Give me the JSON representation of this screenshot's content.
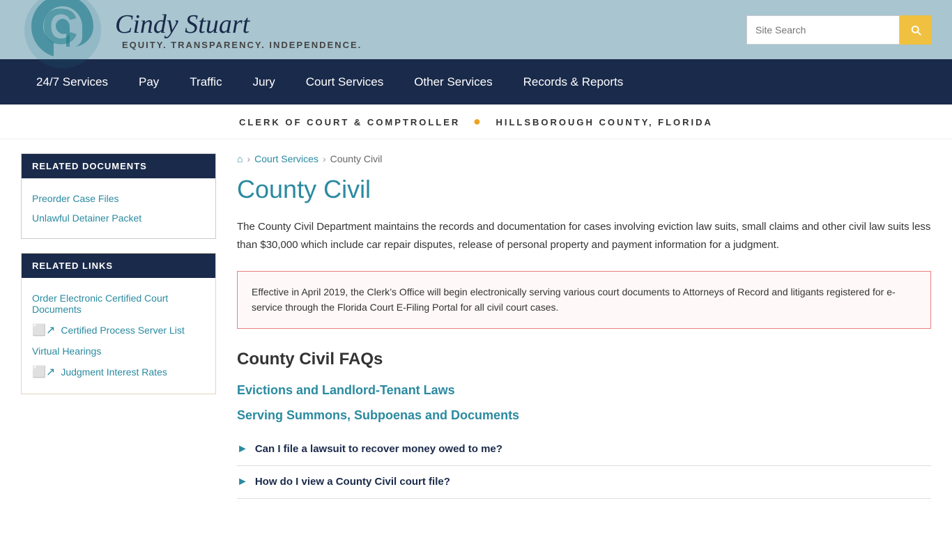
{
  "header": {
    "logo_name": "Cindy Stuart",
    "tagline": "EQUITY. TRANSPARENCY. INDEPENDENCE.",
    "search_placeholder": "Site Search"
  },
  "nav": {
    "items": [
      {
        "label": "24/7 Services",
        "id": "247-services"
      },
      {
        "label": "Pay",
        "id": "pay"
      },
      {
        "label": "Traffic",
        "id": "traffic"
      },
      {
        "label": "Jury",
        "id": "jury"
      },
      {
        "label": "Court Services",
        "id": "court-services"
      },
      {
        "label": "Other Services",
        "id": "other-services"
      },
      {
        "label": "Records & Reports",
        "id": "records-reports"
      }
    ]
  },
  "sub_header": {
    "left": "CLERK OF COURT & COMPTROLLER",
    "right": "HILLSBOROUGH COUNTY, FLORIDA"
  },
  "breadcrumb": {
    "home_label": "Home",
    "items": [
      {
        "label": "Court Services",
        "href": "#"
      },
      {
        "label": "County Civil",
        "href": "#"
      }
    ]
  },
  "page": {
    "title": "County Civil",
    "description": "The County Civil Department maintains the records and documentation for cases involving eviction law suits, small claims and other civil law suits less than $30,000 which include car repair disputes, release of personal property and payment information for a judgment.",
    "notice": "Effective in April 2019, the Clerk’s Office will begin electronically serving various court documents to Attorneys of Record and litigants registered for e-service through the Florida Court E-Filing Portal for all civil court cases.",
    "faq_section_title": "County Civil FAQs",
    "faq_subsections": [
      {
        "title": "Evictions and Landlord-Tenant Laws",
        "questions": []
      },
      {
        "title": "Serving Summons, Subpoenas and Documents",
        "questions": [
          "Can I file a lawsuit to recover money owed to me?",
          "How do I view a County Civil court file?"
        ]
      }
    ]
  },
  "sidebar": {
    "related_documents": {
      "title": "RELATED DOCUMENTS",
      "links": [
        {
          "label": "Preorder Case Files",
          "external": false
        },
        {
          "label": "Unlawful Detainer Packet",
          "external": false
        }
      ]
    },
    "related_links": {
      "title": "RELATED LINKS",
      "links": [
        {
          "label": "Order Electronic Certified Court Documents",
          "external": false
        },
        {
          "label": "Certified Process Server List",
          "external": true
        },
        {
          "label": "Virtual Hearings",
          "external": false
        },
        {
          "label": "Judgment Interest Rates",
          "external": true
        }
      ]
    }
  }
}
